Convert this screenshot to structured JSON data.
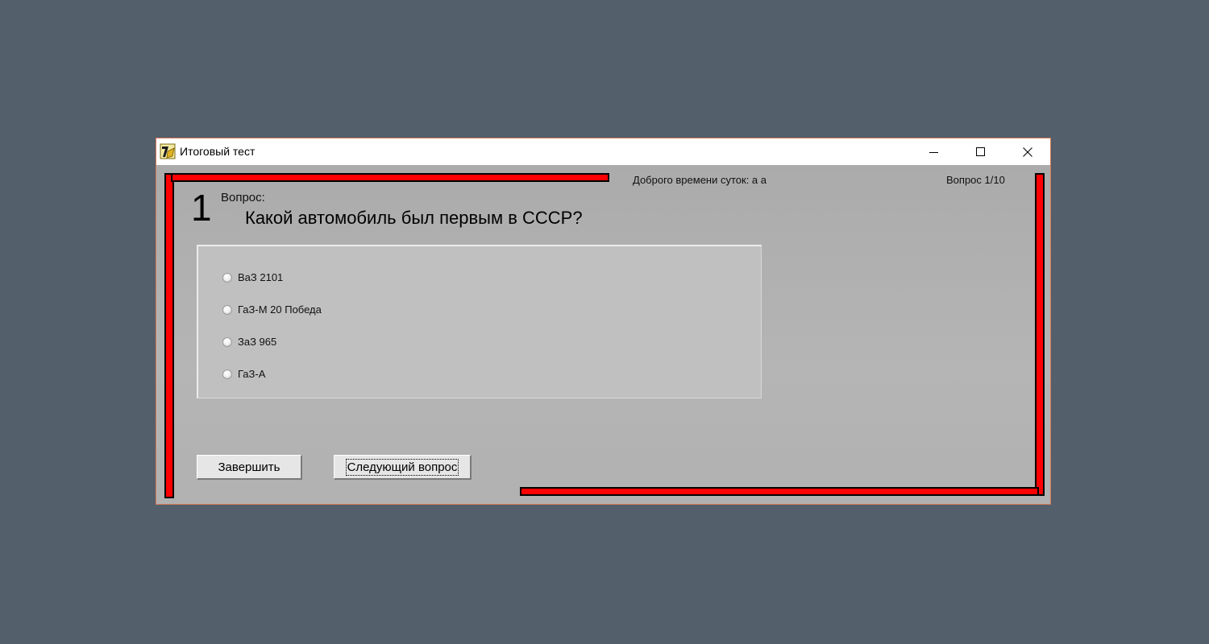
{
  "window": {
    "title": "Итоговый тест"
  },
  "header": {
    "greeting": "Доброго времени суток: а а",
    "counter": "Вопрос 1/10"
  },
  "question": {
    "number": "1",
    "label": "Вопрос:",
    "text": "Какой автомобиль был первым в СССР?"
  },
  "answers": [
    {
      "label": "ВаЗ 2101",
      "selected": false
    },
    {
      "label": "ГаЗ-М 20 Победа",
      "selected": false
    },
    {
      "label": "ЗаЗ 965",
      "selected": false
    },
    {
      "label": "ГаЗ-А",
      "selected": false
    }
  ],
  "buttons": {
    "finish": "Завершить",
    "next": "Следующий вопрос"
  },
  "colors": {
    "accent_bar": "#ff0000",
    "desktop": "#535f6a",
    "form": "#b3b3b3"
  },
  "icons": {
    "app": "delphi-app-icon",
    "minimize": "minimize-icon",
    "maximize": "maximize-icon",
    "close": "close-icon"
  }
}
